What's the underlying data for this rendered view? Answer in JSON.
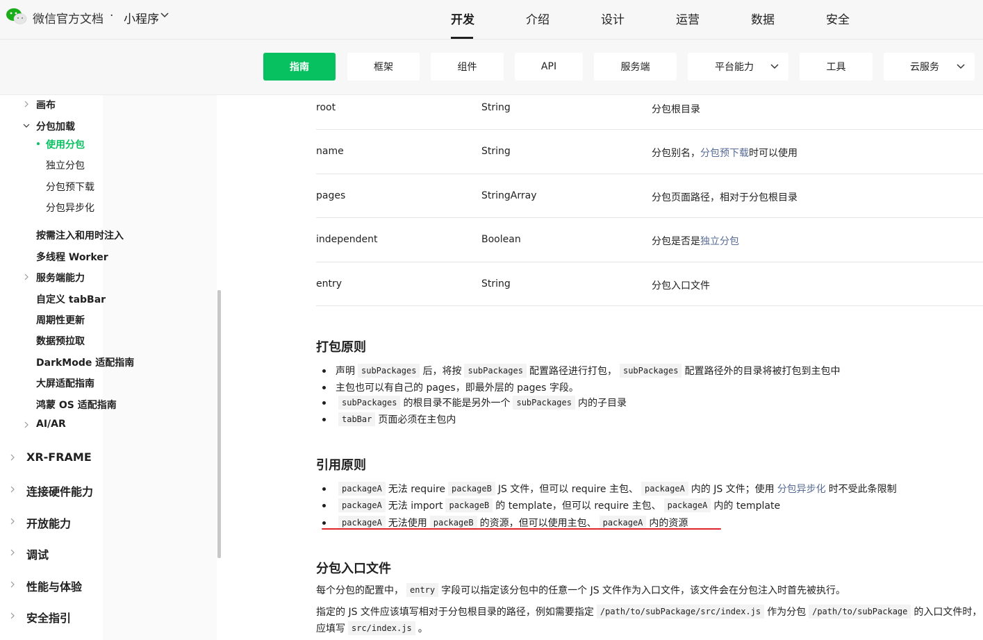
{
  "header": {
    "site_title": "微信官方文档",
    "separator": "·",
    "product": "小程序",
    "nav": [
      {
        "label": "开发",
        "active": true
      },
      {
        "label": "介绍"
      },
      {
        "label": "设计"
      },
      {
        "label": "运营"
      },
      {
        "label": "数据"
      },
      {
        "label": "安全"
      }
    ]
  },
  "subnav": [
    {
      "label": "指南",
      "active": true
    },
    {
      "label": "框架"
    },
    {
      "label": "组件"
    },
    {
      "label": "API"
    },
    {
      "label": "服务端"
    },
    {
      "label": "平台能力",
      "dropdown": true
    },
    {
      "label": "工具"
    },
    {
      "label": "云服务",
      "dropdown": true
    }
  ],
  "sidebar": {
    "items": [
      {
        "label": "画布"
      },
      {
        "label": "分包加载"
      },
      {
        "label": "使用分包",
        "active": true
      },
      {
        "label": "独立分包"
      },
      {
        "label": "分包预下载"
      },
      {
        "label": "分包异步化"
      },
      {
        "label": "按需注入和用时注入"
      },
      {
        "label": "多线程 Worker"
      },
      {
        "label": "服务端能力"
      },
      {
        "label": "自定义 tabBar"
      },
      {
        "label": "周期性更新"
      },
      {
        "label": "数据预拉取"
      },
      {
        "label": "DarkMode 适配指南"
      },
      {
        "label": "大屏适配指南"
      },
      {
        "label": "鸿蒙 OS 适配指南"
      },
      {
        "label": "AI/AR"
      }
    ],
    "sections": [
      {
        "label": "XR-FRAME"
      },
      {
        "label": "连接硬件能力"
      },
      {
        "label": "开放能力"
      },
      {
        "label": "调试"
      },
      {
        "label": "性能与体验"
      },
      {
        "label": "安全指引"
      }
    ]
  },
  "table": {
    "rows": [
      {
        "field": "root",
        "type": "String",
        "desc": "分包根目录"
      },
      {
        "field": "name",
        "type": "String",
        "desc_pre": "分包别名，",
        "desc_link": "分包预下载",
        "desc_post": "时可以使用"
      },
      {
        "field": "pages",
        "type": "StringArray",
        "desc": "分包页面路径，相对于分包根目录"
      },
      {
        "field": "independent",
        "type": "Boolean",
        "desc_pre": "分包是否是",
        "desc_link": "独立分包"
      },
      {
        "field": "entry",
        "type": "String",
        "desc": "分包入口文件"
      }
    ]
  },
  "pack": {
    "title": "打包原则",
    "b1": {
      "t1": "声明",
      "c1": "subPackages",
      "t2": "后，将按",
      "c2": "subPackages",
      "t3": "配置路径进行打包，",
      "c3": "subPackages",
      "t4": "配置路径外的目录将被打包到主包中"
    },
    "b2": {
      "t1": "主包也可以有自己的 pages，即最外层的 pages 字段。"
    },
    "b3": {
      "c1": "subPackages",
      "t1": "的根目录不能是另外一个",
      "c2": "subPackages",
      "t2": "内的子目录"
    },
    "b4": {
      "c1": "tabBar",
      "t1": "页面必须在主包内"
    }
  },
  "refer": {
    "title": "引用原则",
    "b1": {
      "c1": "packageA",
      "t1": "无法 require",
      "c2": "packageB",
      "t2": "JS 文件，但可以 require 主包、",
      "c3": "packageA",
      "t3": "内的 JS 文件；使用",
      "link": "分包异步化",
      "t4": "时不受此条限制"
    },
    "b2": {
      "c1": "packageA",
      "t1": "无法 import",
      "c2": "packageB",
      "t2": "的 template，但可以 require 主包、",
      "c3": "packageA",
      "t3": "内的 template"
    },
    "b3": {
      "c1": "packageA",
      "t1": "无法使用",
      "c2": "packageB",
      "t2": "的资源，但可以使用主包、",
      "c3": "packageA",
      "t3": "内的资源"
    }
  },
  "entry": {
    "title": "分包入口文件",
    "p1": {
      "t1": "每个分包的配置中，",
      "c1": "entry",
      "t2": "字段可以指定该分包中的任意一个 JS 文件作为入口文件，该文件会在分包注入时首先被执行。"
    },
    "p2": {
      "t1": "指定的 JS 文件应该填写相对于分包根目录的路径，例如需要指定",
      "c1": "/path/to/subPackage/src/index.js",
      "t2": "作为分包",
      "c2": "/path/to/subPackage",
      "t3": "的入口文件时，"
    },
    "p3": {
      "t1": "应填写",
      "c1": "src/index.js",
      "t2": "。"
    }
  },
  "colors": {
    "accent": "#07c160",
    "link": "#576b95",
    "highlight": "#e0232b"
  }
}
